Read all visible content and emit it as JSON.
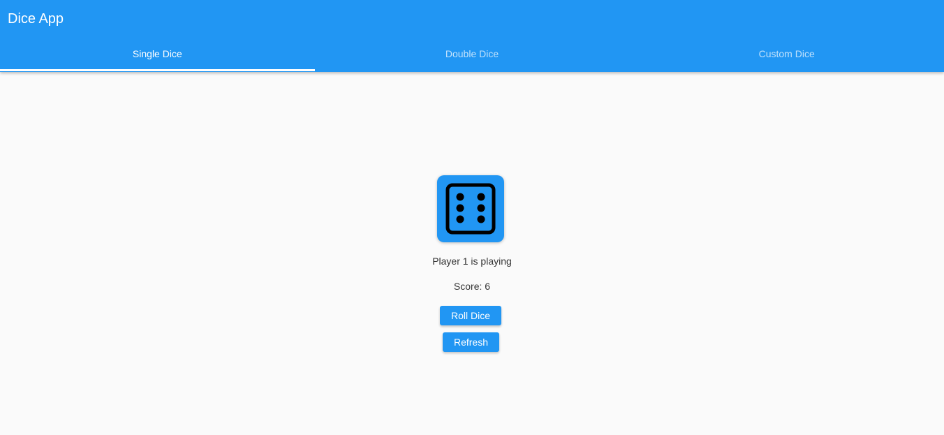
{
  "app": {
    "title": "Dice App"
  },
  "tabs": [
    {
      "label": "Single Dice",
      "active": true
    },
    {
      "label": "Double Dice",
      "active": false
    },
    {
      "label": "Custom Dice",
      "active": false
    }
  ],
  "game": {
    "dice_face": 6,
    "dice_icon": "dice-six-icon",
    "player_status": "Player 1 is playing",
    "score": "Score: 6"
  },
  "buttons": {
    "roll_label": "Roll Dice",
    "refresh_label": "Refresh"
  },
  "colors": {
    "primary": "#2196f3",
    "background": "#fafafa",
    "text": "#333333"
  }
}
